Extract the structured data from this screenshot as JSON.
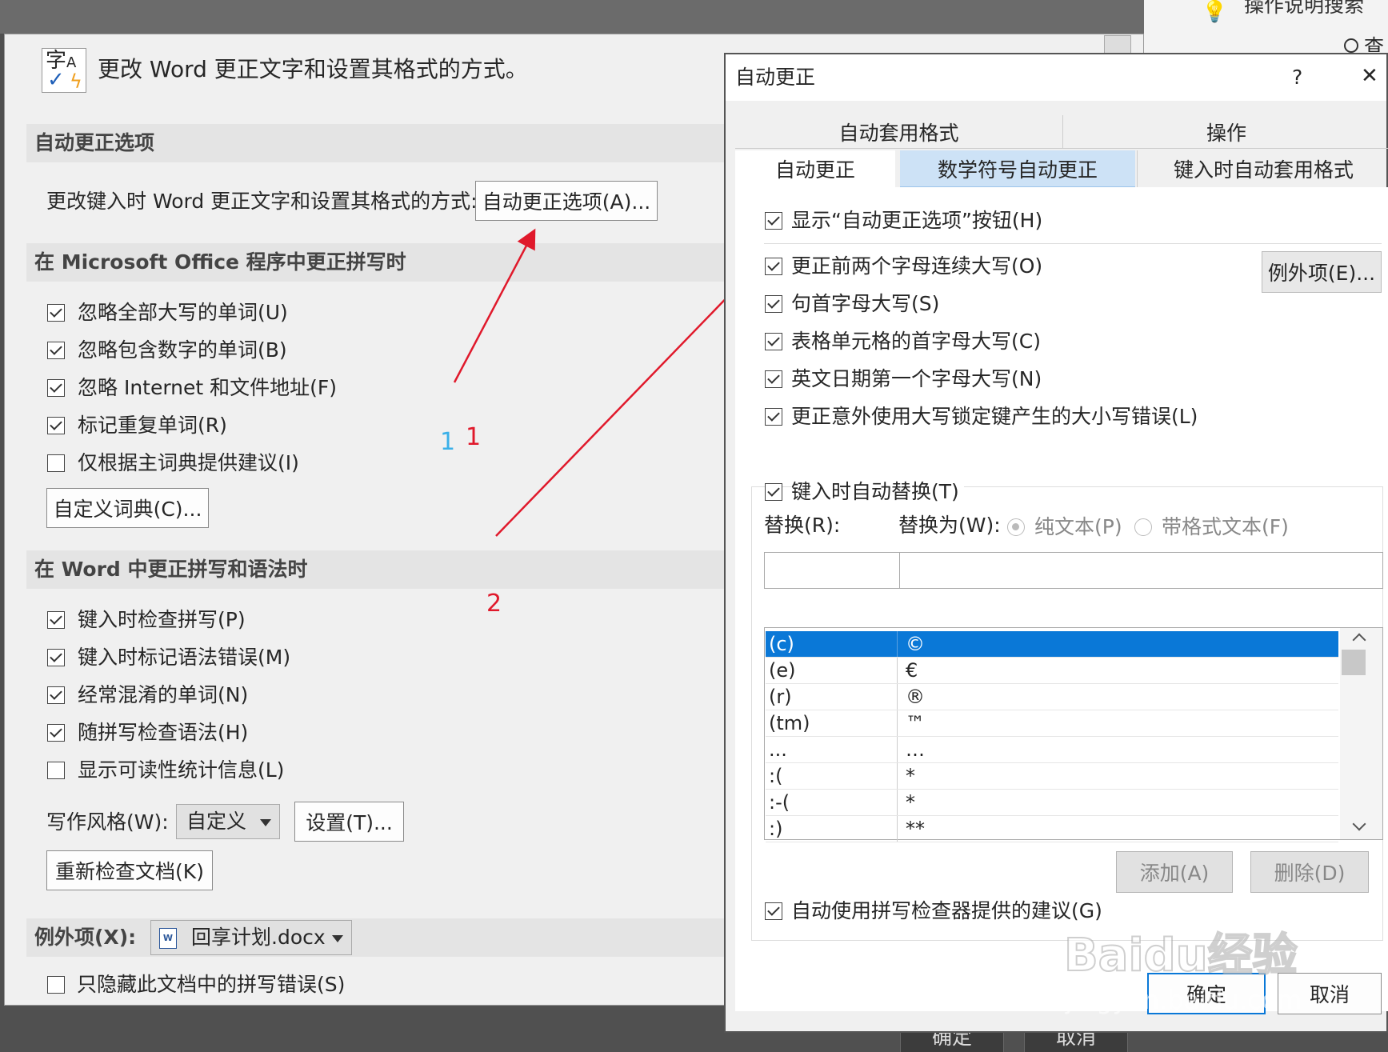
{
  "top": {
    "search_label": "操作说明搜索",
    "right_top_text": "查"
  },
  "left": {
    "header_title": "更改 Word 更正文字和设置其格式的方式。",
    "sec1": {
      "title": "自动更正选项",
      "desc": "更改键入时 Word 更正文字和设置其格式的方式:",
      "button": "自动更正选项(A)..."
    },
    "sec2": {
      "title": "在 Microsoft Office 程序中更正拼写时",
      "items": [
        {
          "label": "忽略全部大写的单词(U)"
        },
        {
          "label": "忽略包含数字的单词(B)"
        },
        {
          "label": "忽略 Internet 和文件地址(F)"
        },
        {
          "label": "标记重复单词(R)"
        },
        {
          "label": "仅根据主词典提供建议(I)"
        }
      ],
      "checked": [
        true,
        true,
        true,
        true,
        false
      ],
      "button": "自定义词典(C)..."
    },
    "sec3": {
      "title": "在 Word 中更正拼写和语法时",
      "items": [
        {
          "label": "键入时检查拼写(P)"
        },
        {
          "label": "键入时标记语法错误(M)"
        },
        {
          "label": "经常混淆的单词(N)"
        },
        {
          "label": "随拼写检查语法(H)"
        },
        {
          "label": "显示可读性统计信息(L)"
        }
      ],
      "checked": [
        true,
        true,
        true,
        true,
        false
      ],
      "style_label": "写作风格(W):",
      "style_value": "自定义",
      "settings_button": "设置(T)...",
      "recheck_button": "重新检查文档(K)"
    },
    "sec4": {
      "title": "例外项(X):",
      "doc": "回享计划.docx",
      "hide_label": "只隐藏此文档中的拼写错误(S)"
    }
  },
  "bottom": {
    "ok": "确定",
    "cancel": "取消"
  },
  "annotations": {
    "a1_blue": "1",
    "a1_red": "1",
    "a2": "2",
    "color": "#e0192b",
    "blue": "#3ab0e8"
  },
  "dialog": {
    "title": "自动更正",
    "help": "?",
    "close": "✕",
    "tabs_row1": [
      "自动套用格式",
      "操作"
    ],
    "tabs_row2": [
      "自动更正",
      "数学符号自动更正",
      "键入时自动套用格式"
    ],
    "show_button_label": "显示“自动更正选项”按钮(H)",
    "opts": [
      {
        "label": "更正前两个字母连续大写(O)"
      },
      {
        "label": "句首字母大写(S)"
      },
      {
        "label": "表格单元格的首字母大写(C)"
      },
      {
        "label": "英文日期第一个字母大写(N)"
      },
      {
        "label": "更正意外使用大写锁定键产生的大小写错误(L)"
      }
    ],
    "exceptions_button": "例外项(E)...",
    "replace_typing": "键入时自动替换(T)",
    "replace_label": "替换(R):",
    "with_label": "替换为(W):",
    "plain": "纯文本(P)",
    "formatted": "带格式文本(F)",
    "list": [
      {
        "k": "(c)",
        "v": "©"
      },
      {
        "k": "(e)",
        "v": "€"
      },
      {
        "k": "(r)",
        "v": "®"
      },
      {
        "k": "(tm)",
        "v": "™"
      },
      {
        "k": "...",
        "v": "…"
      },
      {
        "k": ":(",
        "v": "*"
      },
      {
        "k": ":-(",
        "v": "*"
      },
      {
        "k": ":)",
        "v": "**"
      }
    ],
    "add": "添加(A)",
    "delete": "删除(D)",
    "auto_spell": "自动使用拼写检查器提供的建议(G)",
    "ok": "确定",
    "cancel": "取消"
  },
  "watermark": {
    "brand": "Baidu经验",
    "url": "jingyan.baidu.com"
  }
}
